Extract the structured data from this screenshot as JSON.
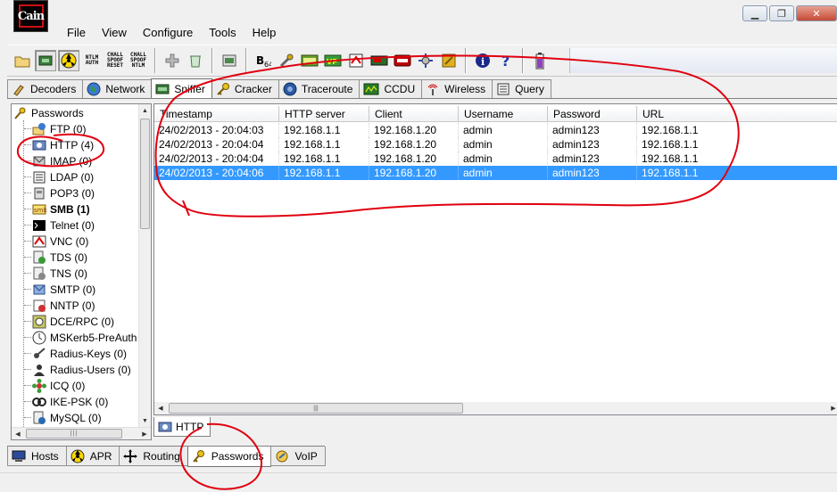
{
  "app": {
    "logo_text": "Cain",
    "menu": [
      "File",
      "View",
      "Configure",
      "Tools",
      "Help"
    ],
    "window_controls": [
      "minimize",
      "restore",
      "close"
    ]
  },
  "toolbar": {
    "buttons": [
      {
        "name": "open-icon"
      },
      {
        "name": "sniffer-start-icon"
      },
      {
        "name": "apr-start-icon"
      },
      {
        "name": "ntlm-auth-icon",
        "label": "NTLM AUTH"
      },
      {
        "name": "chall-spoof-reset-icon",
        "label": "CHALL SPOOF RESET"
      },
      {
        "name": "chall-spoof-ntlm-icon",
        "label": "CHALL SPOOF NTLM"
      },
      {
        "name": "add-icon"
      },
      {
        "name": "remove-icon"
      },
      {
        "name": "configure-icon"
      },
      {
        "name": "base64-icon"
      },
      {
        "name": "tools-icon"
      },
      {
        "name": "hash-calculator-icon"
      },
      {
        "name": "vpn-decoder-icon"
      },
      {
        "name": "rsa-icon"
      },
      {
        "name": "pwl-icon"
      },
      {
        "name": "cisco-icon"
      },
      {
        "name": "network-icon"
      },
      {
        "name": "access-icon"
      },
      {
        "name": "info-icon"
      },
      {
        "name": "help-icon"
      },
      {
        "name": "battery-icon"
      }
    ]
  },
  "top_tabs": [
    {
      "label": "Decoders",
      "icon": "decoders-icon"
    },
    {
      "label": "Network",
      "icon": "globe-icon"
    },
    {
      "label": "Sniffer",
      "icon": "sniffer-icon",
      "active": true
    },
    {
      "label": "Cracker",
      "icon": "key-icon"
    },
    {
      "label": "Traceroute",
      "icon": "traceroute-icon"
    },
    {
      "label": "CCDU",
      "icon": "ccdu-icon"
    },
    {
      "label": "Wireless",
      "icon": "wireless-icon"
    },
    {
      "label": "Query",
      "icon": "query-icon"
    }
  ],
  "tree": {
    "root": "Passwords",
    "items": [
      {
        "label": "FTP (0)",
        "icon": "ftp-icon"
      },
      {
        "label": "HTTP (4)",
        "icon": "http-icon",
        "bold": false
      },
      {
        "label": "IMAP (0)",
        "icon": "imap-icon"
      },
      {
        "label": "LDAP (0)",
        "icon": "ldap-icon"
      },
      {
        "label": "POP3 (0)",
        "icon": "pop3-icon"
      },
      {
        "label": "SMB (1)",
        "icon": "smb-icon",
        "bold": true
      },
      {
        "label": "Telnet (0)",
        "icon": "telnet-icon"
      },
      {
        "label": "VNC (0)",
        "icon": "vnc-icon"
      },
      {
        "label": "TDS (0)",
        "icon": "tds-icon"
      },
      {
        "label": "TNS (0)",
        "icon": "tns-icon"
      },
      {
        "label": "SMTP (0)",
        "icon": "smtp-icon"
      },
      {
        "label": "NNTP (0)",
        "icon": "nntp-icon"
      },
      {
        "label": "DCE/RPC (0)",
        "icon": "dcerpc-icon"
      },
      {
        "label": "MSKerb5-PreAuth",
        "icon": "kerberos-icon"
      },
      {
        "label": "Radius-Keys (0)",
        "icon": "radius-keys-icon"
      },
      {
        "label": "Radius-Users (0)",
        "icon": "radius-users-icon"
      },
      {
        "label": "ICQ (0)",
        "icon": "icq-icon"
      },
      {
        "label": "IKE-PSK (0)",
        "icon": "ike-psk-icon"
      },
      {
        "label": "MySQL (0)",
        "icon": "mysql-icon"
      }
    ]
  },
  "table": {
    "columns": [
      "Timestamp",
      "HTTP server",
      "Client",
      "Username",
      "Password",
      "URL"
    ],
    "rows": [
      [
        "24/02/2013 - 20:04:03",
        "192.168.1.1",
        "192.168.1.20",
        "admin",
        "admin123",
        "192.168.1.1"
      ],
      [
        "24/02/2013 - 20:04:04",
        "192.168.1.1",
        "192.168.1.20",
        "admin",
        "admin123",
        "192.168.1.1"
      ],
      [
        "24/02/2013 - 20:04:04",
        "192.168.1.1",
        "192.168.1.20",
        "admin",
        "admin123",
        "192.168.1.1"
      ],
      [
        "24/02/2013 - 20:04:06",
        "192.168.1.1",
        "192.168.1.20",
        "admin",
        "admin123",
        "192.168.1.1"
      ]
    ],
    "selected_row": 3
  },
  "sub_tab": {
    "label": "HTTP",
    "icon": "http-icon"
  },
  "bottom_tabs": [
    {
      "label": "Hosts",
      "icon": "hosts-icon"
    },
    {
      "label": "APR",
      "icon": "apr-icon"
    },
    {
      "label": "Routing",
      "icon": "routing-icon"
    },
    {
      "label": "Passwords",
      "icon": "passwords-icon",
      "active": true
    },
    {
      "label": "VoIP",
      "icon": "voip-icon"
    }
  ],
  "colors": {
    "selection": "#3399ff",
    "annotation": "#e0000f"
  }
}
